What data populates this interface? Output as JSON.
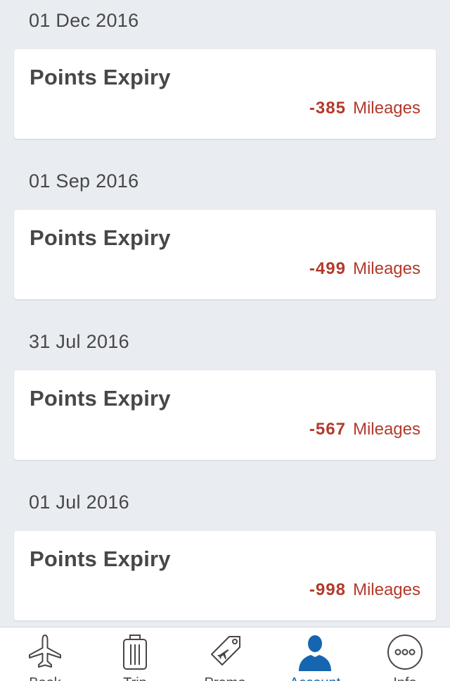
{
  "entries": [
    {
      "date": "01 Dec 2016",
      "title": "Points Expiry",
      "amount": "-385",
      "unit": "Mileages"
    },
    {
      "date": "01 Sep 2016",
      "title": "Points Expiry",
      "amount": "-499",
      "unit": "Mileages"
    },
    {
      "date": "31 Jul 2016",
      "title": "Points Expiry",
      "amount": "-567",
      "unit": "Mileages"
    },
    {
      "date": "01 Jul 2016",
      "title": "Points Expiry",
      "amount": "-998",
      "unit": "Mileages"
    }
  ],
  "tabbar": {
    "tabs": [
      {
        "icon": "airplane-icon",
        "label": "Book"
      },
      {
        "icon": "luggage-icon",
        "label": "Trip"
      },
      {
        "icon": "tag-icon",
        "label": "Promo"
      },
      {
        "icon": "person-icon",
        "label": "Account",
        "active": true
      },
      {
        "icon": "more-icon",
        "label": "Info"
      }
    ]
  },
  "colors": {
    "background": "#e9edf1",
    "card": "#ffffff",
    "text": "#474747",
    "negative_amount": "#b23a2b",
    "active_tab": "#1565b0"
  }
}
